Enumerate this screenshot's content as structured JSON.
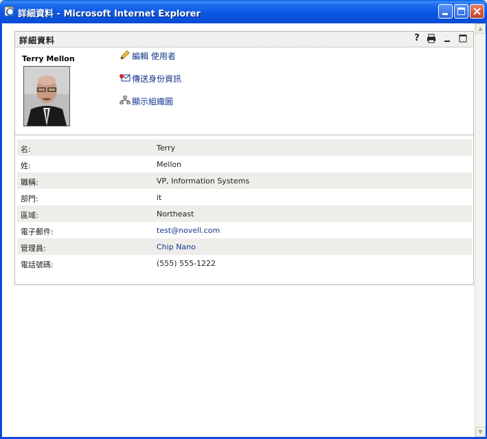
{
  "window": {
    "title": "詳細資料 - Microsoft Internet Explorer"
  },
  "portlet": {
    "title": "詳細資料",
    "icons": [
      "help-icon",
      "print-icon",
      "minimize-icon",
      "maximize-icon"
    ],
    "help_label": "?"
  },
  "user": {
    "name": "Terry Mellon"
  },
  "actions": [
    {
      "label": "編輯 使用者",
      "icon": "pencil-icon"
    },
    {
      "label": "傳送身份資訊",
      "icon": "envelope-icon"
    },
    {
      "label": "顯示組織圖",
      "icon": "org-chart-icon"
    }
  ],
  "details": [
    {
      "label": "名:",
      "value": "Terry",
      "link": false
    },
    {
      "label": "姓:",
      "value": "Mellon",
      "link": false
    },
    {
      "label": "職稱:",
      "value": "VP, Information Systems",
      "link": false
    },
    {
      "label": "部門:",
      "value": "it",
      "link": false
    },
    {
      "label": "區域:",
      "value": "Northeast",
      "link": false
    },
    {
      "label": "電子郵件:",
      "value": "test@novell.com",
      "link": true
    },
    {
      "label": "管理員:",
      "value": "Chip Nano",
      "link": true
    },
    {
      "label": "電話號碼:",
      "value": "(555) 555-1222",
      "link": false
    }
  ],
  "colors": {
    "titlebar": "#0a4cd6",
    "link": "#13368e",
    "alt_row": "#eeede9"
  }
}
